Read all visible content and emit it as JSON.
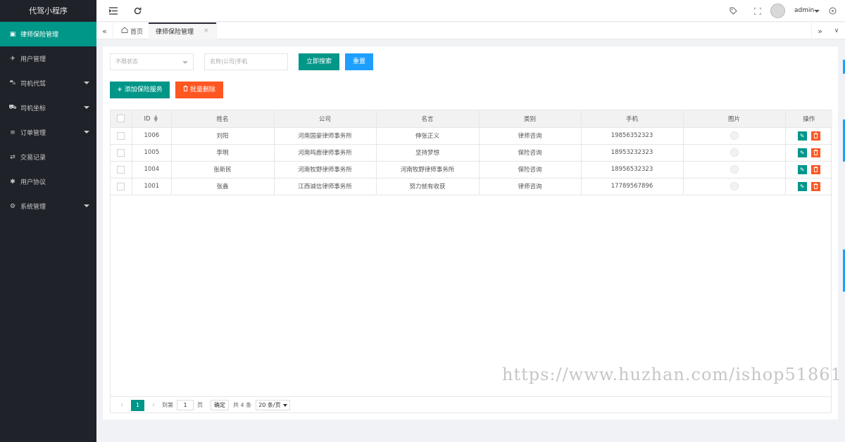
{
  "app": {
    "brand": "代驾小程序"
  },
  "sidebar": {
    "items": [
      {
        "label": "律师保险管理",
        "icon": "insurance-icon",
        "active": true,
        "has_children": false
      },
      {
        "label": "用户管理",
        "icon": "user-icon",
        "active": false,
        "has_children": false
      },
      {
        "label": "司机代驾",
        "icon": "car-icon",
        "active": false,
        "has_children": true
      },
      {
        "label": "司机坐标",
        "icon": "truck-icon",
        "active": false,
        "has_children": true
      },
      {
        "label": "订单管理",
        "icon": "list-icon",
        "active": false,
        "has_children": true
      },
      {
        "label": "交易记录",
        "icon": "handshake-icon",
        "active": false,
        "has_children": false
      },
      {
        "label": "用户协议",
        "icon": "gear-icon",
        "active": false,
        "has_children": false
      },
      {
        "label": "系统管理",
        "icon": "cog-icon",
        "active": false,
        "has_children": true
      }
    ]
  },
  "header": {
    "user": "admin"
  },
  "tabs": {
    "home": "首页",
    "current": "律师保险管理"
  },
  "filters": {
    "status_placeholder": "不限状态",
    "search_placeholder": "名称|公司|手机",
    "search_btn": "立即搜索",
    "reset_btn": "重置"
  },
  "toolbar": {
    "add_btn": "添加保险服务",
    "batch_delete_btn": "批量删除"
  },
  "table": {
    "columns": {
      "id": "ID",
      "name": "姓名",
      "company": "公司",
      "motto": "名言",
      "category": "类别",
      "phone": "手机",
      "image": "图片",
      "ops": "操作"
    },
    "rows": [
      {
        "id": "1006",
        "name": "刘阳",
        "company": "河南国豪律师事务所",
        "motto": "伸张正义",
        "category": "律师咨询",
        "phone": "19856352323"
      },
      {
        "id": "1005",
        "name": "李明",
        "company": "河南鸣鹿律师事务所",
        "motto": "坚持梦想",
        "category": "保险咨询",
        "phone": "18953232323"
      },
      {
        "id": "1004",
        "name": "张新民",
        "company": "河南牧野律师事务所",
        "motto": "河南牧野律师事务所",
        "category": "保险咨询",
        "phone": "18956532323"
      },
      {
        "id": "1001",
        "name": "张鑫",
        "company": "江西诚信律师事务所",
        "motto": "努力就有收获",
        "category": "律师咨询",
        "phone": "17789567896"
      }
    ]
  },
  "pager": {
    "current": "1",
    "goto_label": "到第",
    "goto_value": "1",
    "page_unit": "页",
    "confirm": "确定",
    "total": "共 4 条",
    "page_size": "20 条/页"
  },
  "watermark": "https://www.huzhan.com/ishop51861",
  "colors": {
    "sidebar_bg": "#20222a",
    "accent": "#009688",
    "blue": "#1e9fff",
    "danger": "#ff5722"
  }
}
